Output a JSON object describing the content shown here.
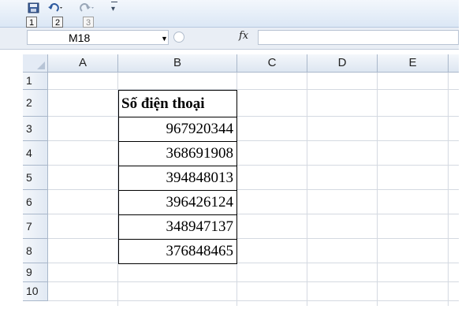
{
  "quick_access": {
    "keytips": [
      "1",
      "2",
      "3"
    ],
    "icons": [
      "save-icon",
      "undo-icon",
      "redo-icon",
      "customize-icon"
    ]
  },
  "formula_bar": {
    "name_box": "M18",
    "fx_label": "fx",
    "formula": ""
  },
  "sheet": {
    "columns": [
      "A",
      "B",
      "C",
      "D",
      "E"
    ],
    "rows": [
      "1",
      "2",
      "3",
      "4",
      "5",
      "6",
      "7",
      "8",
      "9",
      "10"
    ],
    "table": {
      "header": "Số điện thoại",
      "values": [
        "967920344",
        "368691908",
        "394848013",
        "396426124",
        "348947137",
        "376848465"
      ]
    }
  },
  "colors": {
    "header_bg": "#dde6f1",
    "grid": "#d4d9e1",
    "toolbar": "#dbe7f5"
  }
}
